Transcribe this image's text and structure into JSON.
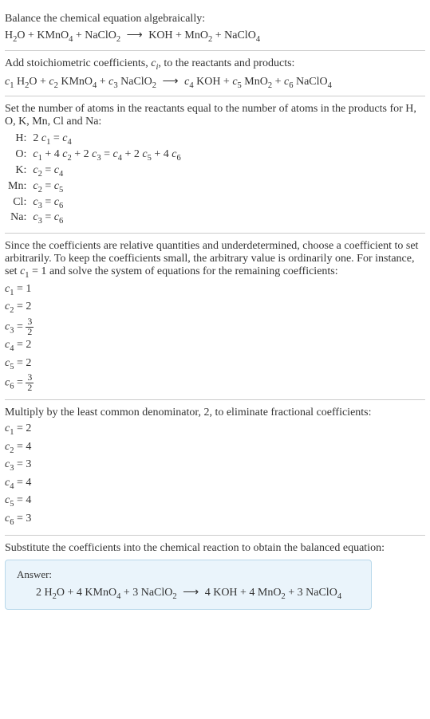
{
  "section1": {
    "intro": "Balance the chemical equation algebraically:",
    "equation": "H₂O + KMnO₄ + NaClO₂ ⟶ KOH + MnO₂ + NaClO₄"
  },
  "section2": {
    "intro_part1": "Add stoichiometric coefficients, ",
    "intro_ci": "cᵢ",
    "intro_part2": ", to the reactants and products:",
    "equation": "c₁ H₂O + c₂ KMnO₄ + c₃ NaClO₂ ⟶ c₄ KOH + c₅ MnO₂ + c₆ NaClO₄"
  },
  "section3": {
    "intro": "Set the number of atoms in the reactants equal to the number of atoms in the products for H, O, K, Mn, Cl and Na:",
    "rows": [
      {
        "el": "H:",
        "eq": "2 c₁ = c₄"
      },
      {
        "el": "O:",
        "eq": "c₁ + 4 c₂ + 2 c₃ = c₄ + 2 c₅ + 4 c₆"
      },
      {
        "el": "K:",
        "eq": "c₂ = c₄"
      },
      {
        "el": "Mn:",
        "eq": "c₂ = c₅"
      },
      {
        "el": "Cl:",
        "eq": "c₃ = c₆"
      },
      {
        "el": "Na:",
        "eq": "c₃ = c₆"
      }
    ]
  },
  "section4": {
    "intro_part1": "Since the coefficients are relative quantities and underdetermined, choose a coefficient to set arbitrarily. To keep the coefficients small, the arbitrary value is ordinarily one. For instance, set ",
    "intro_c1": "c₁ = 1",
    "intro_part2": " and solve the system of equations for the remaining coefficients:",
    "coeffs": [
      {
        "lhs": "c₁",
        "rhs": "1",
        "frac": false
      },
      {
        "lhs": "c₂",
        "rhs": "2",
        "frac": false
      },
      {
        "lhs": "c₃",
        "num": "3",
        "den": "2",
        "frac": true
      },
      {
        "lhs": "c₄",
        "rhs": "2",
        "frac": false
      },
      {
        "lhs": "c₅",
        "rhs": "2",
        "frac": false
      },
      {
        "lhs": "c₆",
        "num": "3",
        "den": "2",
        "frac": true
      }
    ]
  },
  "section5": {
    "intro": "Multiply by the least common denominator, 2, to eliminate fractional coefficients:",
    "coeffs": [
      {
        "lhs": "c₁",
        "rhs": "2"
      },
      {
        "lhs": "c₂",
        "rhs": "4"
      },
      {
        "lhs": "c₃",
        "rhs": "3"
      },
      {
        "lhs": "c₄",
        "rhs": "4"
      },
      {
        "lhs": "c₅",
        "rhs": "4"
      },
      {
        "lhs": "c₆",
        "rhs": "3"
      }
    ]
  },
  "section6": {
    "intro": "Substitute the coefficients into the chemical reaction to obtain the balanced equation:",
    "answer_label": "Answer:",
    "answer_eq": "2 H₂O + 4 KMnO₄ + 3 NaClO₂ ⟶ 4 KOH + 4 MnO₂ + 3 NaClO₄"
  }
}
